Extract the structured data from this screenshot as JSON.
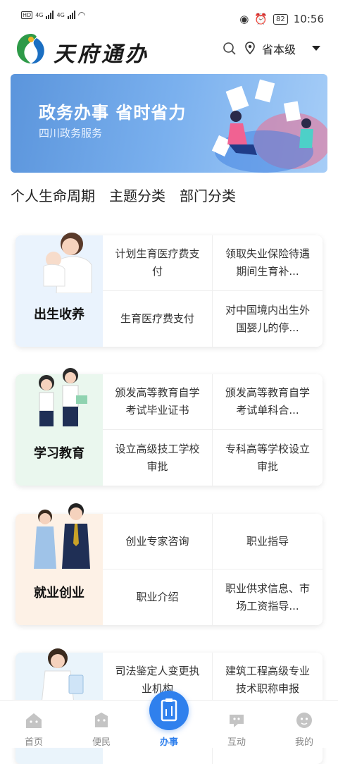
{
  "status": {
    "net1": "HD",
    "net2": "HD",
    "sig1": "4G",
    "sig2": "4G",
    "battery": "82",
    "time": "10:56"
  },
  "header": {
    "app_title": "天府通办",
    "location_level": "省本级"
  },
  "banner": {
    "title": "政务办事 省时省力",
    "subtitle": "四川政务服务"
  },
  "tabs": [
    "个人生命周期",
    "主题分类",
    "部门分类"
  ],
  "sections": [
    {
      "label": "出生收养",
      "items": [
        "计划生育医疗费支付",
        "领取失业保险待遇期间生育补...",
        "生育医疗费支付",
        "对中国境内出生外国婴儿的停..."
      ]
    },
    {
      "label": "学习教育",
      "items": [
        "颁发高等教育自学考试毕业证书",
        "颁发高等教育自学考试单科合...",
        "设立高级技工学校审批",
        "专科高等学校设立审批"
      ]
    },
    {
      "label": "就业创业",
      "items": [
        "创业专家咨询",
        "职业指导",
        "职业介绍",
        "职业供求信息、市场工资指导..."
      ]
    },
    {
      "label": "",
      "items": [
        "司法鉴定人变更执业机构",
        "建筑工程高级专业技术职称申报",
        "",
        ""
      ]
    }
  ],
  "nav": [
    "首页",
    "便民",
    "办事",
    "互动",
    "我的"
  ],
  "colors": {
    "accent": "#2f80ed",
    "banner": "#6ea7ea",
    "card_birth": "#eaf3fd",
    "card_edu": "#eaf7ee",
    "card_job": "#fdf1e6",
    "card_law": "#eaf4fb"
  }
}
